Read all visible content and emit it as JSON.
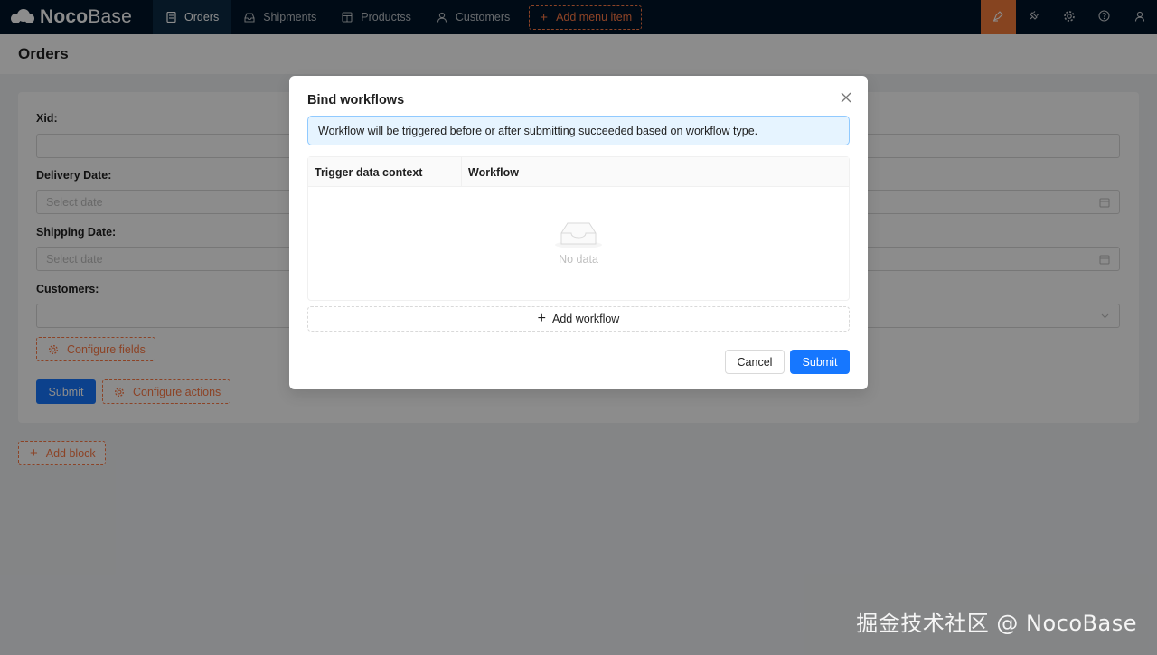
{
  "brand": {
    "name_bold": "Noco",
    "name_light": "Base"
  },
  "nav": {
    "items": [
      {
        "label": "Orders",
        "icon": "file-icon"
      },
      {
        "label": "Shipments",
        "icon": "inbox-icon"
      },
      {
        "label": "Productss",
        "icon": "table-icon"
      },
      {
        "label": "Customers",
        "icon": "user-icon"
      }
    ],
    "add_menu_label": "Add menu item"
  },
  "topbar_right": [
    "design-mode-icon",
    "plugin-icon",
    "settings-icon",
    "help-icon",
    "user-icon"
  ],
  "page": {
    "title": "Orders"
  },
  "form": {
    "fields": [
      {
        "label": "Xid",
        "placeholder": ""
      },
      {
        "label": "Delivery Date",
        "placeholder": "Select date"
      },
      {
        "label": "Shipping Date",
        "placeholder": "Select date"
      },
      {
        "label": "Customers",
        "placeholder": ""
      }
    ],
    "configure_fields_label": "Configure fields",
    "submit_label": "Submit",
    "configure_actions_label": "Configure actions"
  },
  "add_block_label": "Add block",
  "modal": {
    "title": "Bind workflows",
    "alert": "Workflow will be triggered before or after submitting succeeded based on workflow type.",
    "columns": [
      "Trigger data context",
      "Workflow"
    ],
    "empty_text": "No data",
    "add_workflow_label": "Add workflow",
    "cancel_label": "Cancel",
    "submit_label": "Submit"
  },
  "watermark": "掘金技术社区 @ NocoBase",
  "colors": {
    "primary": "#1677ff",
    "accent": "#ff7a45",
    "topbar": "#001529"
  }
}
